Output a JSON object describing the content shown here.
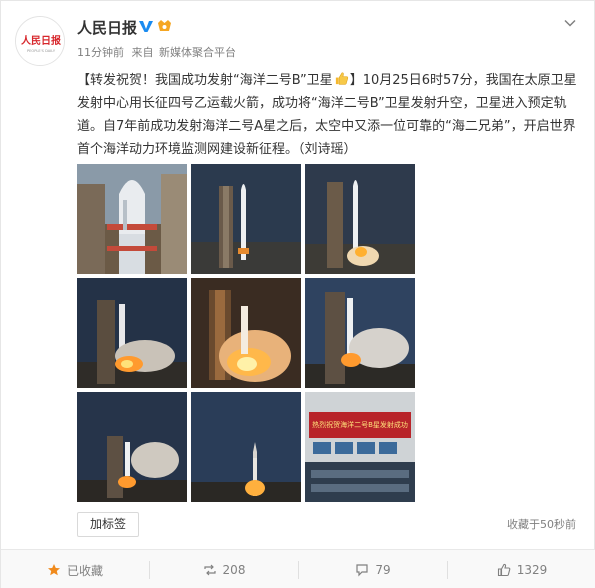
{
  "post": {
    "username": "人民日报",
    "avatar_text": "人民日报",
    "avatar_subtext": "PEOPLE'S DAILY",
    "time": "11分钟前",
    "source_prefix": "来自",
    "source": "新媒体聚合平台",
    "text_lead": "【转发祝贺！我国成功发射“海洋二号B”卫星",
    "text_after_emoji": "】10月25日6时57分，我国在太原卫星发射中心用长征四号乙运载火箭，成功将“海洋二号B”卫星发射升空，卫星进入预定轨道。自7年前成功发射海洋二号A星之后，太空中又添一位可靠的“海二兄弟”，开启世界首个海洋动力环境监测网建设新征程。（刘诗瑶）",
    "banner_text": "热烈祝贺海洋二号B星发射成功",
    "icons": {
      "verified": "verified-icon",
      "vip": "vip-icon",
      "emoji": "thumbs-up-emoji",
      "more": "chevron-down-icon",
      "fav": "star-icon",
      "repost": "repost-icon",
      "comment": "comment-icon",
      "like": "like-icon"
    }
  },
  "actions": {
    "add_tag": "加标签",
    "fav_count": "收藏于50秒前"
  },
  "footer": {
    "favorite": "已收藏",
    "repost": "208",
    "comment": "79",
    "like": "1329"
  },
  "colors": {
    "brand_red": "#d7272c",
    "verified": "#1a8bf0",
    "vip": "#f5a623",
    "meta_gray": "#808080",
    "fav_orange": "#f08a1c"
  }
}
